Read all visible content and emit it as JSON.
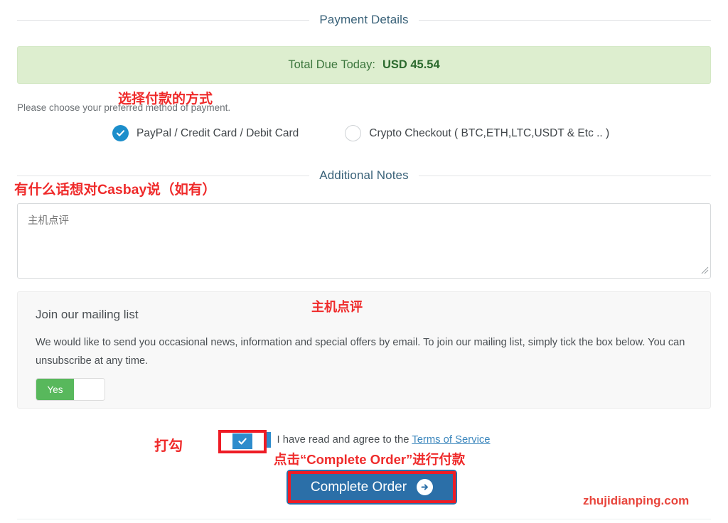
{
  "sections": {
    "payment_details_title": "Payment Details",
    "additional_notes_title": "Additional Notes"
  },
  "total": {
    "label": "Total Due Today:",
    "value": "USD 45.54",
    "bg_color": "#ddeecf",
    "text_color": "#3c763d"
  },
  "payment": {
    "instruction": "Please choose your preferred method of payment.",
    "options": [
      {
        "label": "PayPal / Credit Card / Debit Card",
        "selected": true
      },
      {
        "label": "Crypto Checkout ( BTC,ETH,LTC,USDT & Etc .. )",
        "selected": false
      }
    ]
  },
  "notes": {
    "value": "",
    "placeholder": "主机点评"
  },
  "mailing_list": {
    "title": "Join our mailing list",
    "body": "We would like to send you occasional news, information and special offers by email. To join our mailing list, simply tick the box below. You can unsubscribe at any time.",
    "toggle_on_label": "Yes",
    "toggle_state": "Yes",
    "toggle_color": "#58b85c"
  },
  "terms": {
    "text_before": "I have read and agree to the ",
    "link_label": "Terms of Service",
    "checked": true,
    "link_color": "#3c87bd"
  },
  "complete_order": {
    "label": "Complete Order",
    "icon": "arrow-right-circle-icon",
    "bg_color": "#2b6fa8"
  },
  "annotations": {
    "color": "#ef2b2b",
    "choose_payment": "选择付款的方式",
    "notes_prompt": "有什么话想对Casbay说（如有）",
    "mailing_note": "主机点评",
    "tick_label": "打勾",
    "click_button": "点击“Complete Order”进行付款",
    "watermark": "zhujidianping.com"
  }
}
